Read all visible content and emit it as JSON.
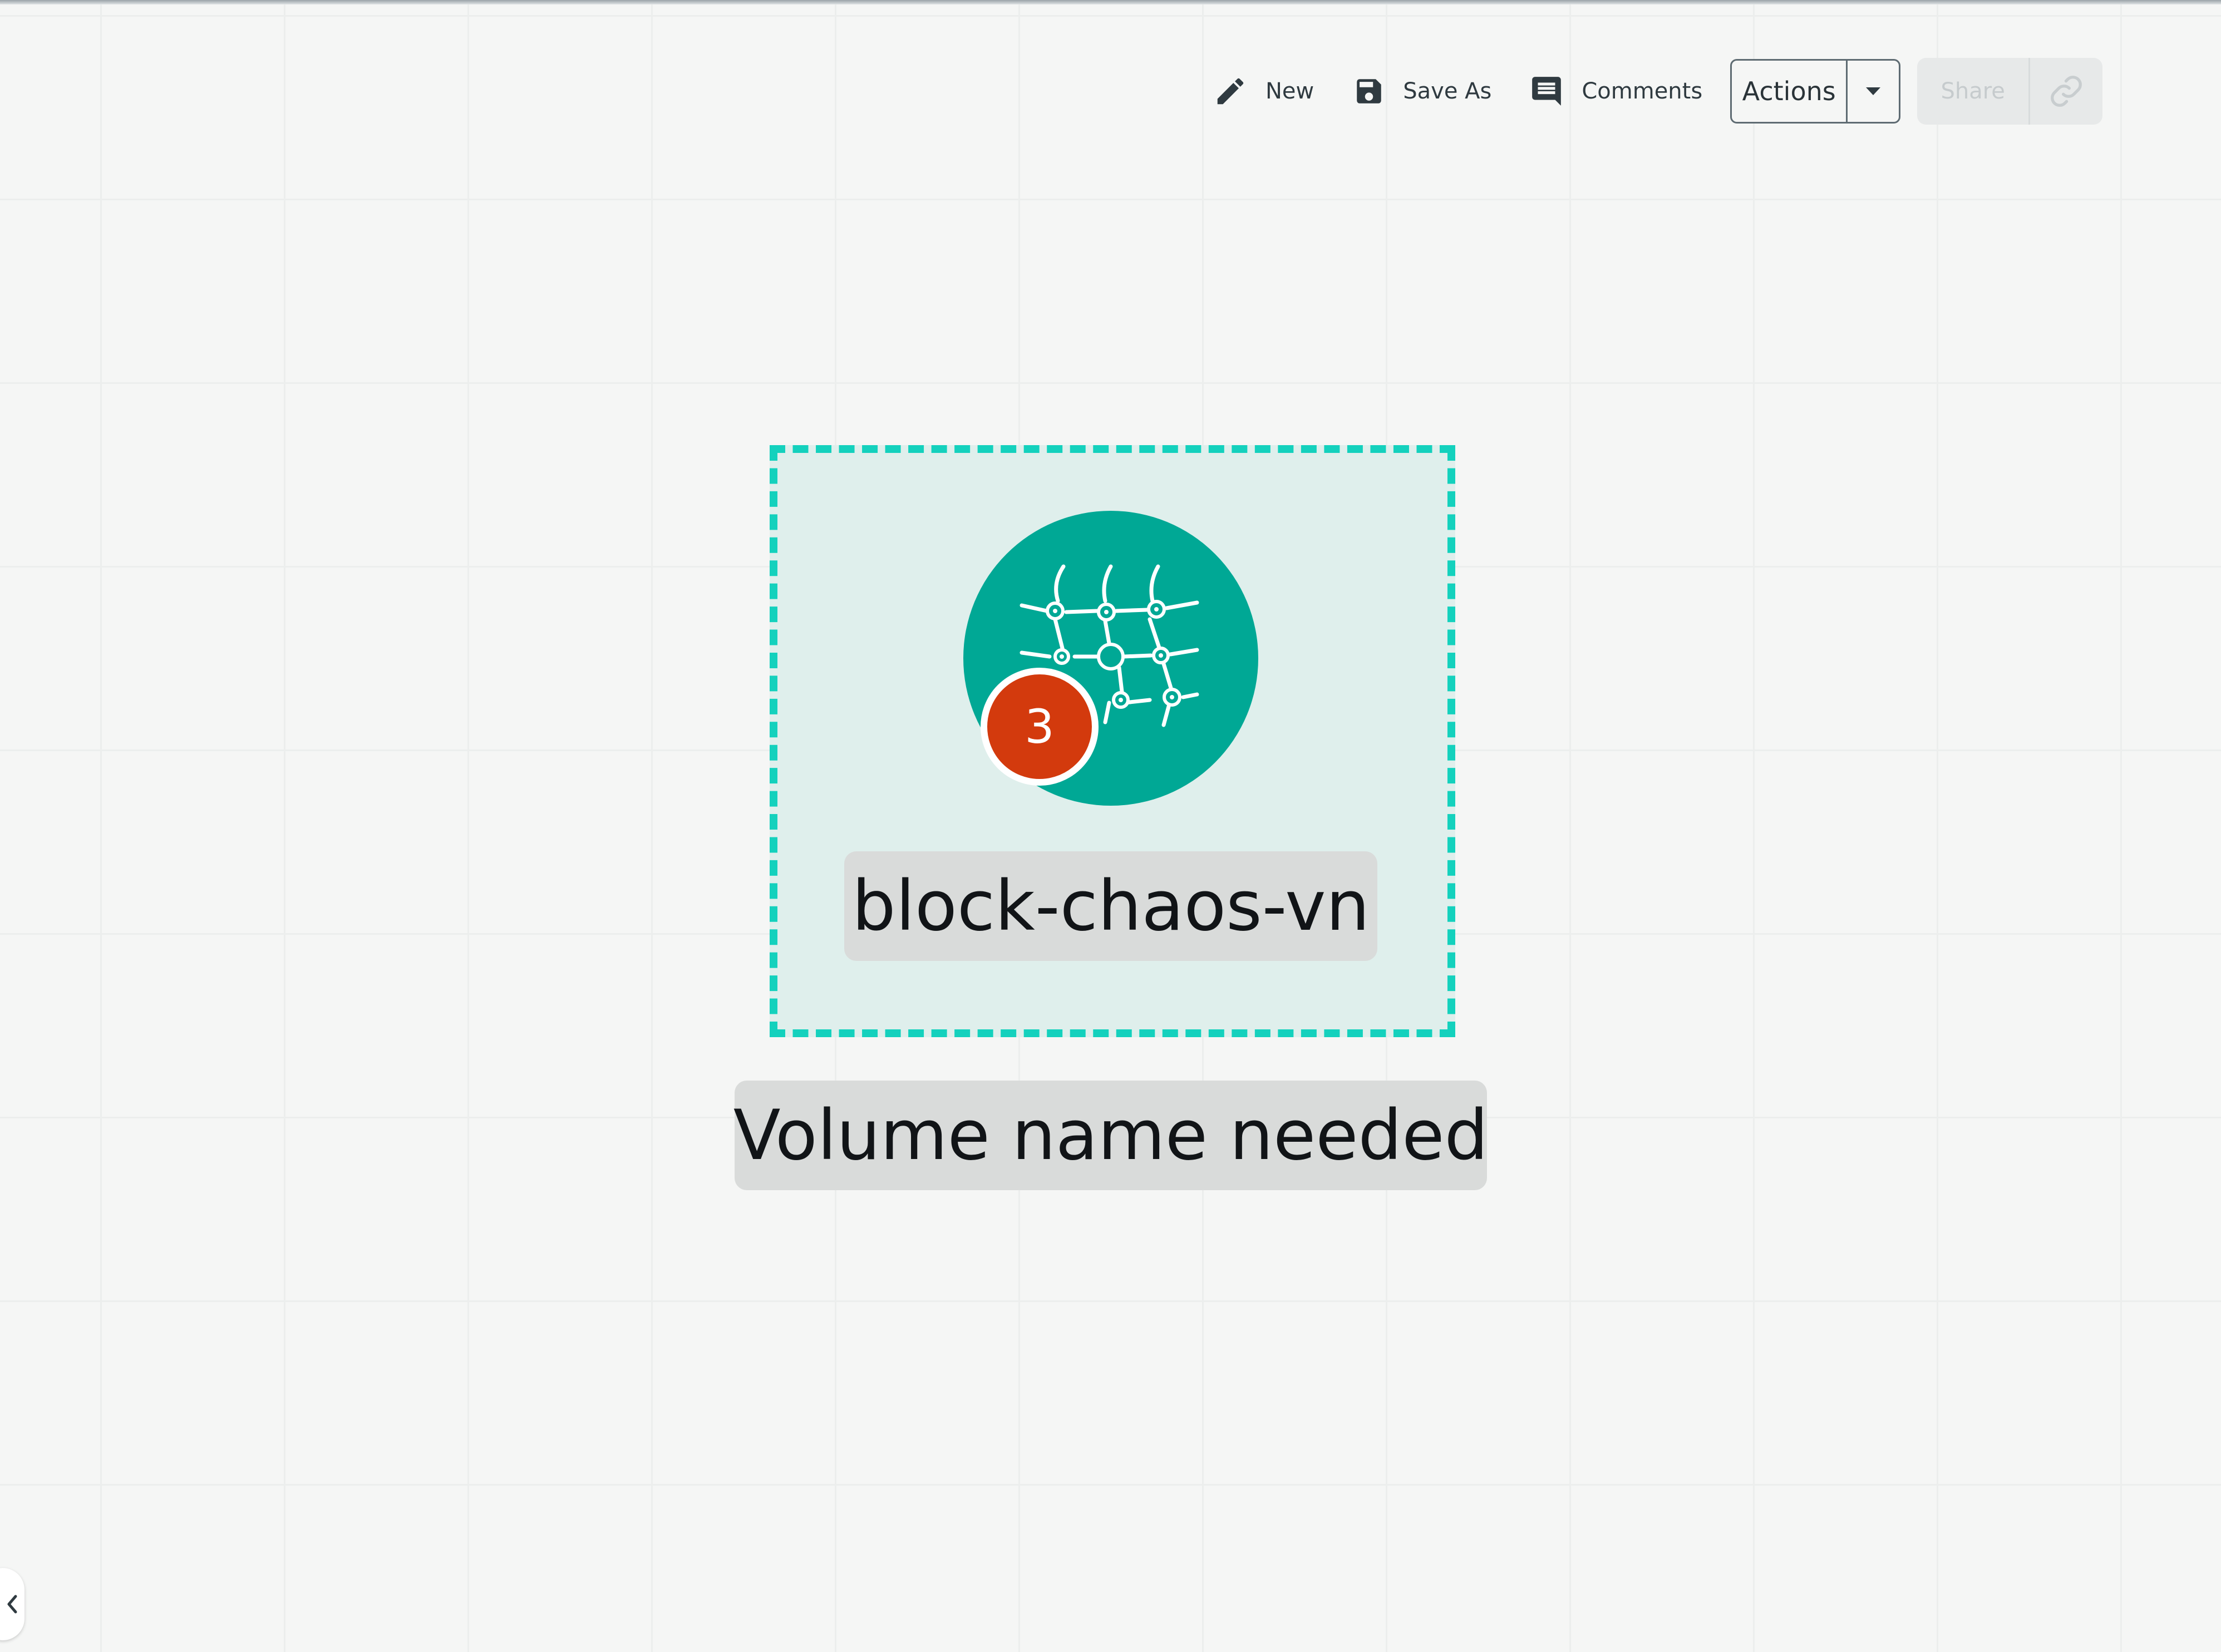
{
  "toolbar": {
    "new_label": "New",
    "save_as_label": "Save As",
    "comments_label": "Comments",
    "actions_label": "Actions",
    "share_label": "Share"
  },
  "canvas": {
    "node": {
      "name": "block-chaos-vn",
      "badge_count": "3",
      "icon": "network-mesh-icon"
    },
    "warning_label": "Volume name needed"
  },
  "colors": {
    "node_fill": "#00a895",
    "node_dashed_border": "#14d1bd",
    "badge": "#d33a0d"
  },
  "icons": {
    "new": "pencil-icon",
    "save_as": "floppy-disk-icon",
    "comments": "comment-icon",
    "actions_caret": "caret-down-icon",
    "share_link": "link-icon",
    "side_toggle": "chevron-left-icon"
  }
}
